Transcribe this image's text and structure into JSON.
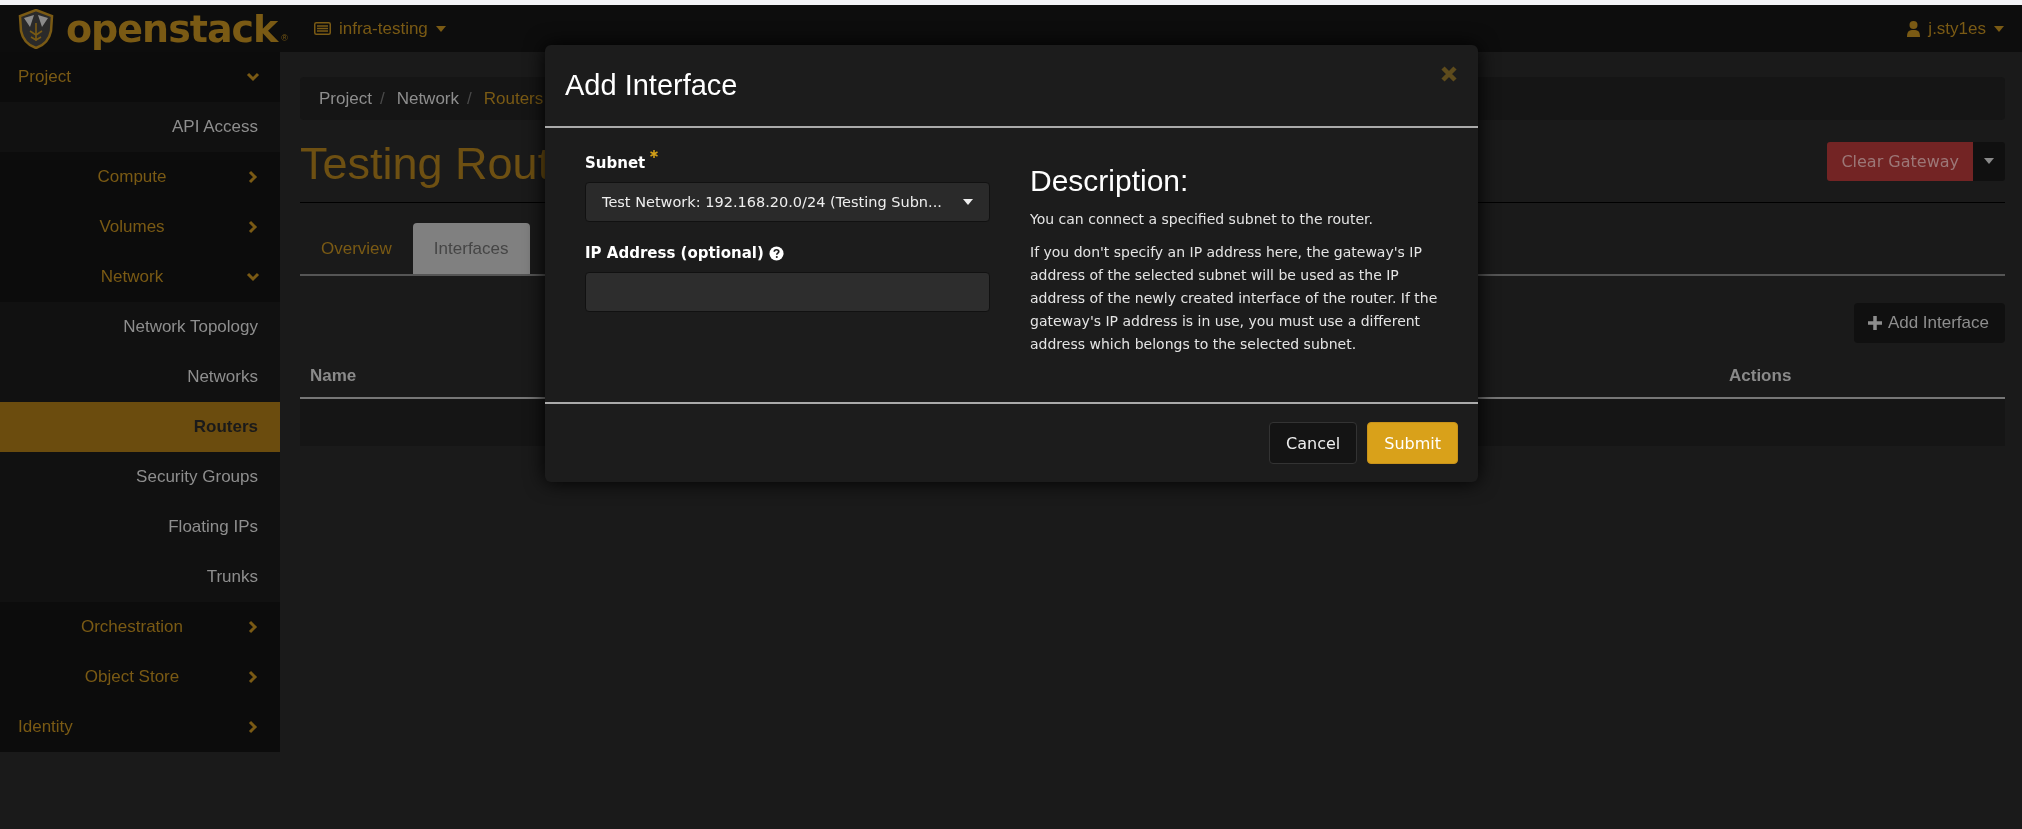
{
  "header": {
    "logo_text": "openstack",
    "logo_mark": "®",
    "project_menu": "infra-testing",
    "user_menu": "j.sty1es"
  },
  "sidebar": {
    "items": [
      {
        "kind": "group",
        "label": "Project",
        "expanded": true,
        "children": [
          {
            "kind": "link",
            "label": "API Access",
            "selected": false
          },
          {
            "kind": "group",
            "label": "Compute",
            "expanded": false
          },
          {
            "kind": "group",
            "label": "Volumes",
            "expanded": false
          },
          {
            "kind": "group",
            "label": "Network",
            "expanded": true,
            "children": [
              {
                "kind": "link",
                "label": "Network Topology",
                "selected": false
              },
              {
                "kind": "link",
                "label": "Networks",
                "selected": false
              },
              {
                "kind": "link",
                "label": "Routers",
                "selected": true
              },
              {
                "kind": "link",
                "label": "Security Groups",
                "selected": false
              },
              {
                "kind": "link",
                "label": "Floating IPs",
                "selected": false
              },
              {
                "kind": "link",
                "label": "Trunks",
                "selected": false
              }
            ]
          },
          {
            "kind": "group",
            "label": "Orchestration",
            "expanded": false
          },
          {
            "kind": "group",
            "label": "Object Store",
            "expanded": false
          }
        ]
      },
      {
        "kind": "group",
        "label": "Identity",
        "expanded": false
      }
    ]
  },
  "breadcrumb": {
    "items": [
      {
        "label": "Project",
        "link": false
      },
      {
        "label": "Network",
        "link": false
      },
      {
        "label": "Routers",
        "link": true
      }
    ],
    "separator": "/"
  },
  "page": {
    "title": "Testing Rout",
    "primary_action": "Clear Gateway"
  },
  "tabs": [
    {
      "label": "Overview",
      "selected": false
    },
    {
      "label": "Interfaces",
      "selected": true
    }
  ],
  "table": {
    "action": "Add Interface",
    "columns": [
      "Name",
      "Actions"
    ]
  },
  "dialog": {
    "title": "Add Interface",
    "fields": [
      {
        "kind": "select",
        "label": "Subnet",
        "required": true,
        "help": false,
        "value": "Test Network: 192.168.20.0/24 (Testing Subn..."
      },
      {
        "kind": "text",
        "label": "IP Address (optional)",
        "required": false,
        "help": true
      }
    ],
    "description_title": "Description:",
    "description": [
      "You can connect a specified subnet to the router.",
      "If you don't specify an IP address here, the gateway's IP address of the selected subnet will be used as the IP address of the newly created interface of the router. If the gateway's IP address is in use, you must use a different address which belongs to the selected subnet."
    ],
    "buttons": [
      {
        "kind": "secondary",
        "label": "Cancel"
      },
      {
        "kind": "primary",
        "label": "Submit"
      }
    ]
  }
}
